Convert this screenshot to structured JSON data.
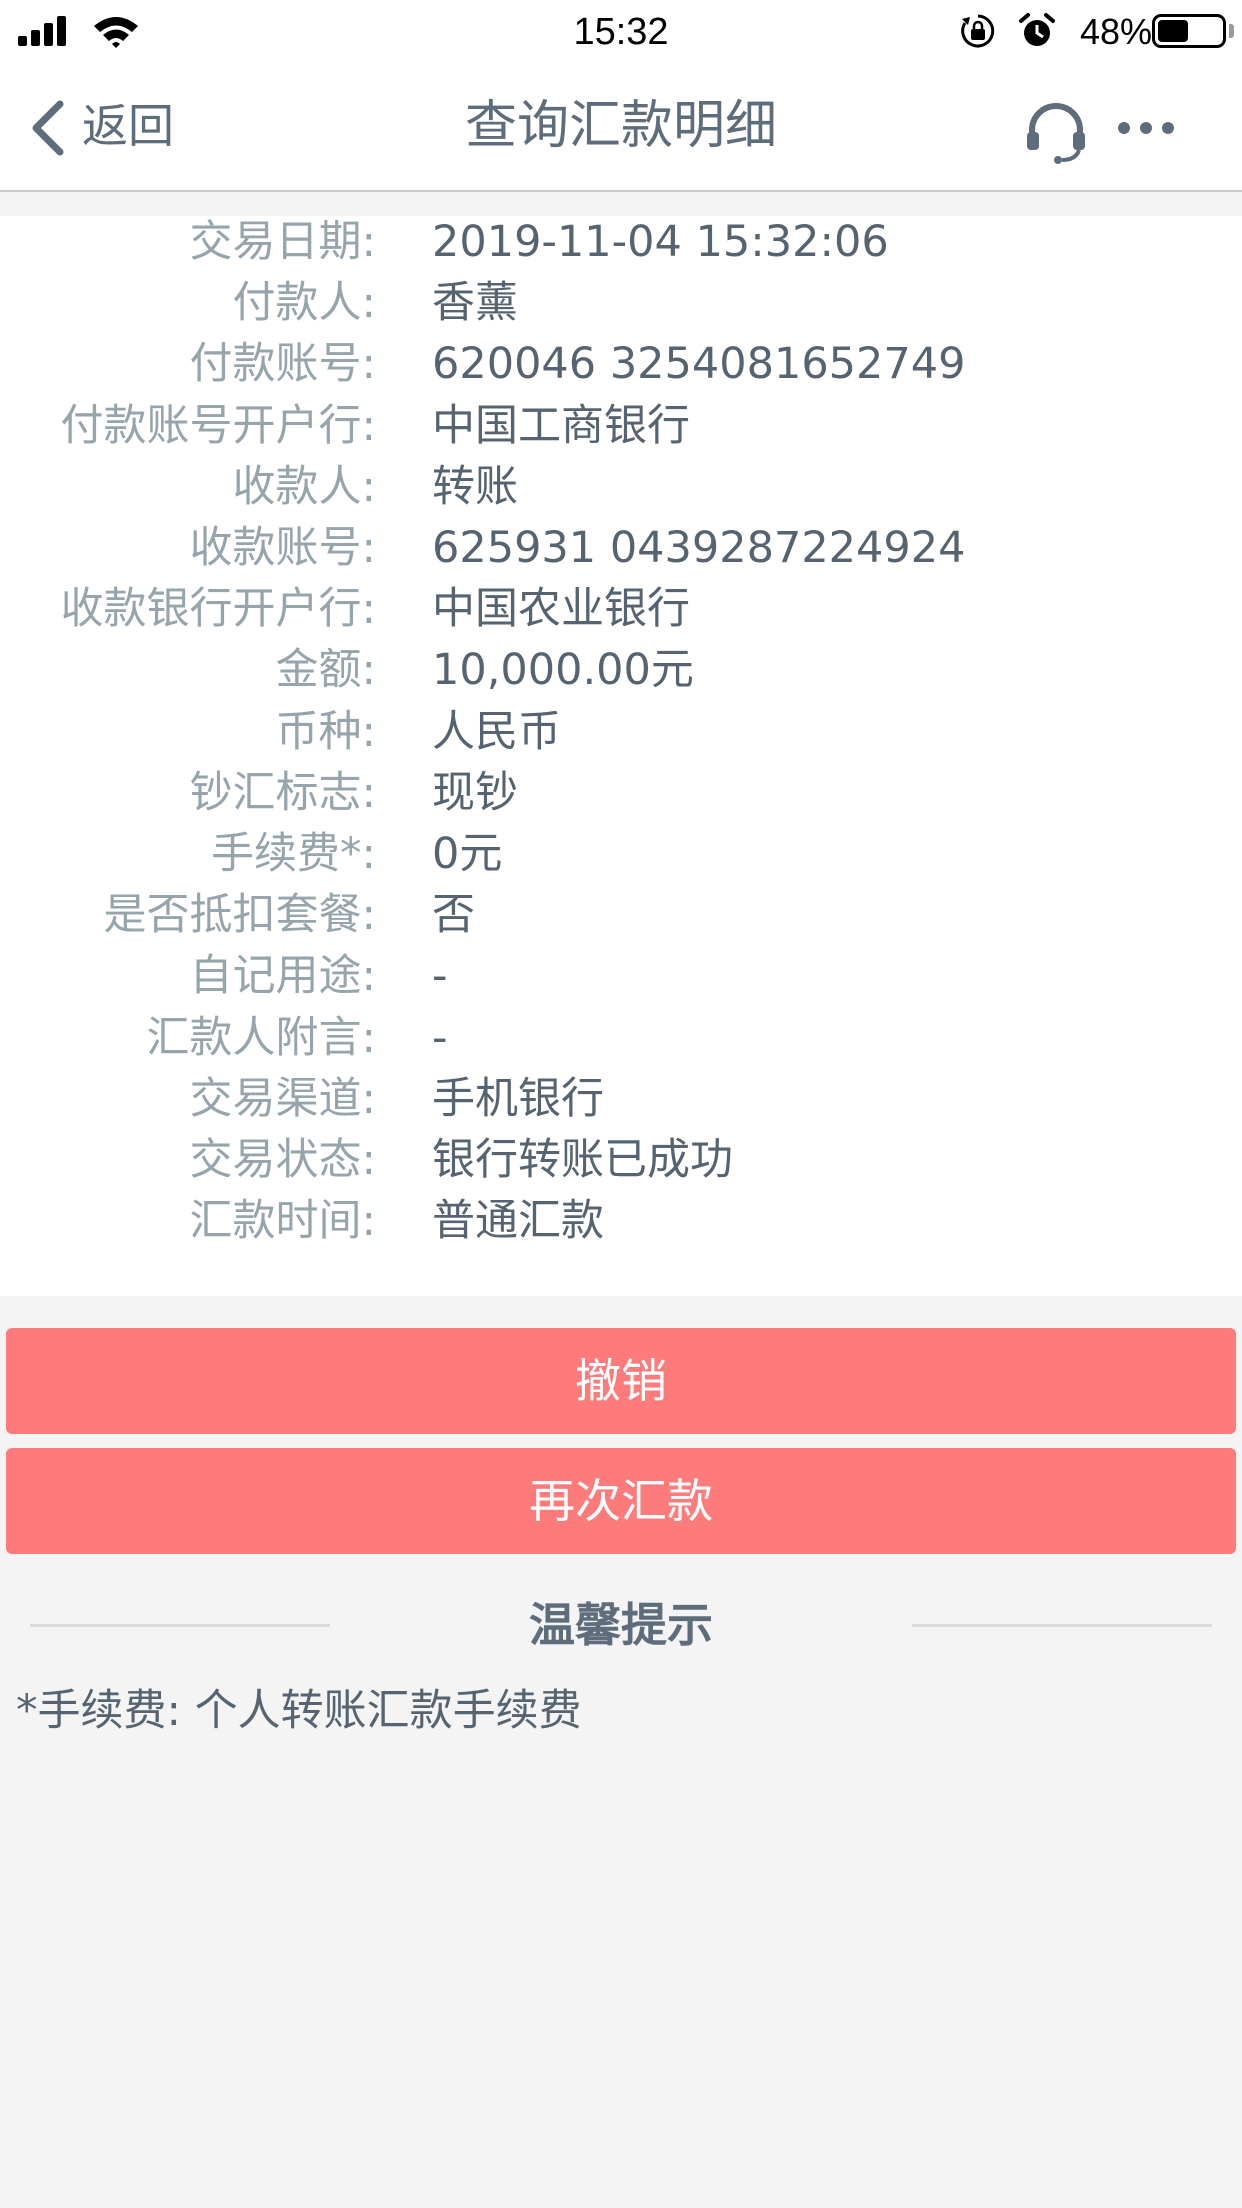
{
  "status_bar": {
    "time": "15:32",
    "battery_percent": "48%",
    "battery_level": 0.48
  },
  "nav": {
    "back_label": "返回",
    "title": "查询汇款明细",
    "support_icon": "headset-icon",
    "more_icon": "more-dots-icon"
  },
  "details": [
    {
      "label": "交易日期:",
      "value": "2019-11-04 15:32:06"
    },
    {
      "label": "付款人:",
      "value": "香薰"
    },
    {
      "label": "付款账号:",
      "value": "620046 3254081652749"
    },
    {
      "label": "付款账号开户行:",
      "value": "中国工商银行"
    },
    {
      "label": "收款人:",
      "value": "转账"
    },
    {
      "label": "收款账号:",
      "value": "625931 0439287224924"
    },
    {
      "label": "收款银行开户行:",
      "value": "中国农业银行"
    },
    {
      "label": "金额:",
      "value": "10,000.00元"
    },
    {
      "label": "币种:",
      "value": "人民币"
    },
    {
      "label": "钞汇标志:",
      "value": "现钞"
    },
    {
      "label": "手续费*:",
      "value": "0元"
    },
    {
      "label": "是否抵扣套餐:",
      "value": "否"
    },
    {
      "label": "自记用途:",
      "value": "-"
    },
    {
      "label": "汇款人附言:",
      "value": "-"
    },
    {
      "label": "交易渠道:",
      "value": "手机银行"
    },
    {
      "label": "交易状态:",
      "value": "银行转账已成功"
    },
    {
      "label": "汇款时间:",
      "value": "普通汇款"
    }
  ],
  "actions": {
    "cancel_label": "撤销",
    "again_label": "再次汇款"
  },
  "tips": {
    "title": "温馨提示",
    "text": "*手续费: 个人转账汇款手续费"
  },
  "colors": {
    "button": "#fe7b7b",
    "label": "#96a5ac",
    "value": "#556470",
    "background": "#f4f4f5"
  }
}
